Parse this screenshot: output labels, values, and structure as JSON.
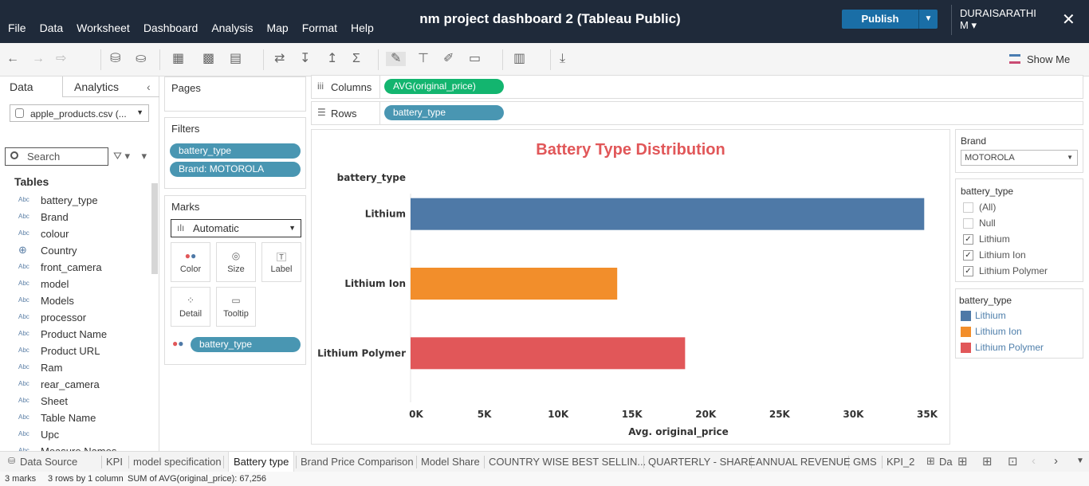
{
  "window": {
    "title": "nm project dashboard 2 (Tableau Public)",
    "publish_label": "Publish",
    "user_name": "DURAISARATHI M",
    "user_caret": "▾",
    "close": "✕"
  },
  "menu": [
    "File",
    "Data",
    "Worksheet",
    "Dashboard",
    "Analysis",
    "Map",
    "Format",
    "Help"
  ],
  "toolbar": {
    "show_me_label": "Show Me"
  },
  "data_pane": {
    "tab_data": "Data",
    "tab_analytics": "Analytics",
    "collapse": "‹",
    "source": "apple_products.csv (...",
    "search_placeholder": "Search",
    "tables_heading": "Tables",
    "fields": [
      {
        "type": "Abc",
        "name": "battery_type"
      },
      {
        "type": "Abc",
        "name": "Brand"
      },
      {
        "type": "Abc",
        "name": "colour"
      },
      {
        "type": "⊕",
        "name": "Country"
      },
      {
        "type": "Abc",
        "name": "front_camera"
      },
      {
        "type": "Abc",
        "name": "model"
      },
      {
        "type": "Abc",
        "name": "Models"
      },
      {
        "type": "Abc",
        "name": "processor"
      },
      {
        "type": "Abc",
        "name": "Product Name"
      },
      {
        "type": "Abc",
        "name": "Product URL"
      },
      {
        "type": "Abc",
        "name": "Ram"
      },
      {
        "type": "Abc",
        "name": "rear_camera"
      },
      {
        "type": "Abc",
        "name": "Sheet"
      },
      {
        "type": "Abc",
        "name": "Table Name"
      },
      {
        "type": "Abc",
        "name": "Upc"
      },
      {
        "type": "Abc",
        "name": "Measure Names"
      }
    ]
  },
  "cards": {
    "pages_title": "Pages",
    "filters_title": "Filters",
    "filters": [
      "battery_type",
      "Brand: MOTOROLA"
    ],
    "marks_title": "Marks",
    "mark_type": "Automatic",
    "mark_buttons": [
      "Color",
      "Size",
      "Label",
      "Detail",
      "Tooltip"
    ],
    "color_pill": "battery_type"
  },
  "shelves": {
    "columns_label": "Columns",
    "columns_pill": "AVG(original_price)",
    "rows_label": "Rows",
    "rows_pill": "battery_type"
  },
  "chart_data": {
    "type": "bar",
    "orientation": "horizontal",
    "title": "Battery Type Distribution",
    "row_header": "battery_type",
    "categories": [
      "Lithium",
      "Lithium Ion",
      "Lithium Polymer"
    ],
    "values": [
      34800,
      14000,
      18600
    ],
    "colors": [
      "#4e79a7",
      "#f28e2b",
      "#e15759"
    ],
    "xlabel": "Avg. original_price",
    "xlim": [
      0,
      35000
    ],
    "xticks": [
      "0K",
      "5K",
      "10K",
      "15K",
      "20K",
      "25K",
      "30K",
      "35K"
    ],
    "tick_values": [
      0,
      5000,
      10000,
      15000,
      20000,
      25000,
      30000,
      35000
    ],
    "title_color": "#e15759"
  },
  "brand_filter": {
    "title": "Brand",
    "value": "MOTOROLA"
  },
  "battery_filter": {
    "title": "battery_type",
    "items": [
      {
        "label": "(All)",
        "checked": false
      },
      {
        "label": "Null",
        "checked": false
      },
      {
        "label": "Lithium",
        "checked": true
      },
      {
        "label": "Lithium Ion",
        "checked": true
      },
      {
        "label": "Lithium Polymer",
        "checked": true
      }
    ]
  },
  "legend": {
    "title": "battery_type",
    "items": [
      {
        "label": "Lithium",
        "color": "#4e79a7"
      },
      {
        "label": "Lithium Ion",
        "color": "#f28e2b"
      },
      {
        "label": "Lithium Polymer",
        "color": "#e15759"
      }
    ]
  },
  "sheet_tabs": [
    "Data Source",
    "KPI",
    "model specification",
    "Battery type",
    "Brand Price Comparison",
    "Model Share",
    "COUNTRY WISE BEST SELLIN...",
    "QUARTERLY - SHARE",
    "ANNUAL REVENUE",
    "GMS",
    "KPI_2",
    "Da"
  ],
  "active_tab": "Battery type",
  "status": {
    "marks": "3 marks",
    "dims": "3 rows by 1 column",
    "sum": "SUM of AVG(original_price): 67,256"
  }
}
